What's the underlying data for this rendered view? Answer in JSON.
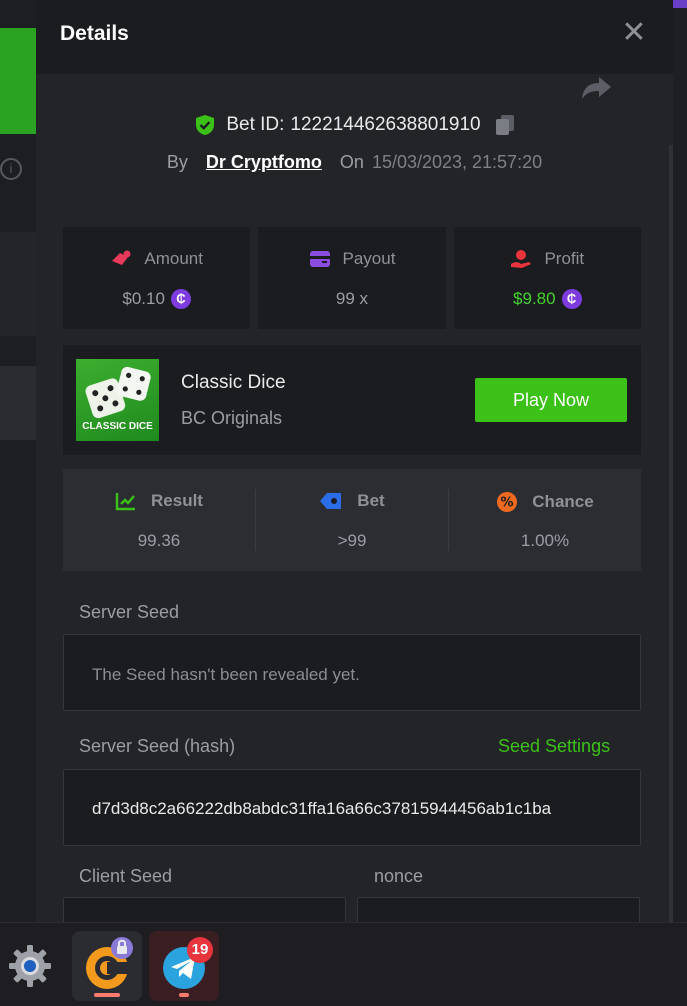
{
  "modal": {
    "title": "Details",
    "close_glyph": "✕"
  },
  "bet": {
    "id_label": "Bet ID:",
    "id_value": "122214462638801910",
    "by_label": "By",
    "user": "Dr Cryptfomo",
    "on_label": "On",
    "datetime": "15/03/2023, 21:57:20"
  },
  "stats": [
    {
      "label": "Amount",
      "value": "$0.10",
      "icon": "amount-icon",
      "coin": true
    },
    {
      "label": "Payout",
      "value": "99 x",
      "icon": "wallet-icon",
      "coin": false
    },
    {
      "label": "Profit",
      "value": "$9.80",
      "icon": "profit-icon",
      "coin": true
    }
  ],
  "game": {
    "thumb_label": "CLASSIC DICE",
    "name": "Classic Dice",
    "provider": "BC Originals",
    "play_label": "Play Now"
  },
  "result": [
    {
      "label": "Result",
      "value": "99.36",
      "icon": "result-chart-icon"
    },
    {
      "label": "Bet",
      "value": ">99",
      "icon": "bet-icon"
    },
    {
      "label": "Chance",
      "value": "1.00%",
      "icon": "percent-icon"
    }
  ],
  "seeds": {
    "server_label": "Server Seed",
    "server_value": "The Seed hasn't been revealed yet.",
    "hash_label": "Server Seed (hash)",
    "settings_label": "Seed Settings",
    "hash_value": "d7d3d8c2a66222db8abdc31ffa16a66c37815944456ab1c1ba",
    "client_label": "Client Seed",
    "nonce_label": "nonce"
  },
  "coin_glyph": "₵",
  "taskbar": {
    "telegram_badge": "19"
  },
  "colors": {
    "accent_green": "#3bc117",
    "profit_green": "#43d22c",
    "coin_purple": "#7e3ce0"
  }
}
